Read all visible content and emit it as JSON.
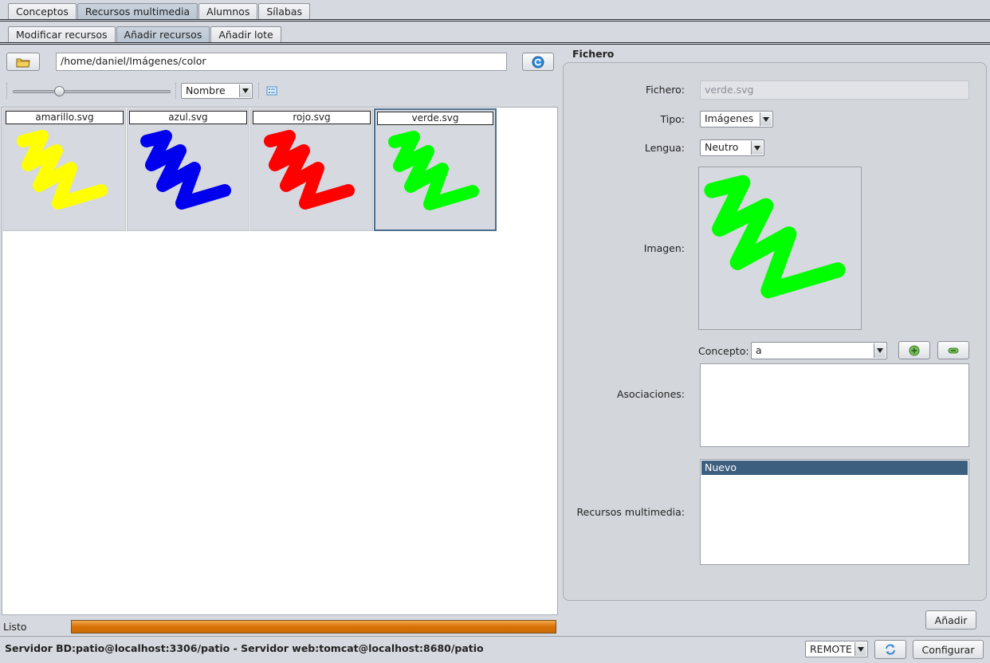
{
  "tabs_main": [
    {
      "label": "Conceptos",
      "active": false
    },
    {
      "label": "Recursos multimedia",
      "active": true
    },
    {
      "label": "Alumnos",
      "active": false
    },
    {
      "label": "Sílabas",
      "active": false
    }
  ],
  "tabs_sub": [
    {
      "label": "Modificar recursos",
      "active": false
    },
    {
      "label": "Añadir recursos",
      "active": true
    },
    {
      "label": "Añadir lote",
      "active": false
    }
  ],
  "left": {
    "path_value": "/home/daniel/Imágenes/color",
    "sort_value": "Nombre",
    "thumbnails": [
      {
        "name": "amarillo.svg",
        "color": "#ffff00"
      },
      {
        "name": "azul.svg",
        "color": "#0000ee"
      },
      {
        "name": "rojo.svg",
        "color": "#ff0000"
      },
      {
        "name": "verde.svg",
        "color": "#00ff00"
      }
    ],
    "selected_index": 3
  },
  "panel": {
    "title": "Fichero",
    "fichero_label": "Fichero:",
    "fichero_value": "verde.svg",
    "tipo_label": "Tipo:",
    "tipo_value": "Imágenes",
    "lengua_label": "Lengua:",
    "lengua_value": "Neutro",
    "imagen_label": "Imagen:",
    "imagen_color": "#00ff00",
    "concepto_label": "Concepto:",
    "concepto_value": "a",
    "asociaciones_label": "Asociaciones:",
    "recursos_label": "Recursos multimedia:",
    "recursos_items": [
      "Nuevo"
    ]
  },
  "status": {
    "text": "Listo",
    "progress_percent": 100,
    "add_button": "Añadir"
  },
  "footer": {
    "server_text": "Servidor BD:patio@localhost:3306/patio - Servidor web:tomcat@localhost:8680/patio",
    "mode_value": "REMOTE",
    "configure_button": "Configurar"
  },
  "colors": {
    "accent": "#3d5f7f",
    "progress": "#d97206"
  }
}
